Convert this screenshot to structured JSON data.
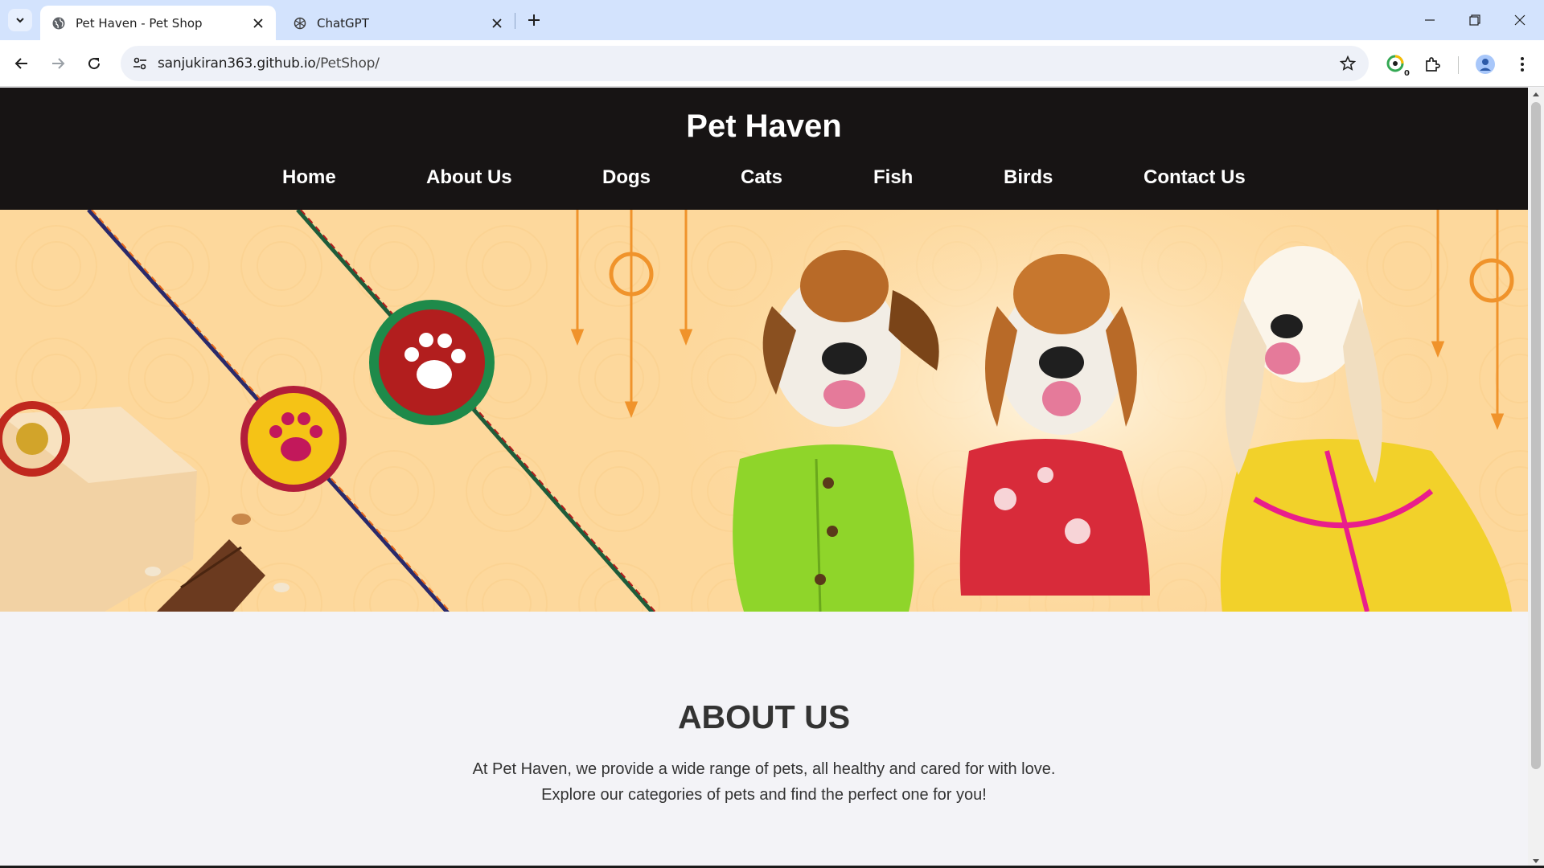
{
  "browser": {
    "tabs": [
      {
        "title": "Pet Haven - Pet Shop",
        "active": true,
        "favicon": "globe-icon"
      },
      {
        "title": "ChatGPT",
        "active": false,
        "favicon": "chatgpt-icon"
      }
    ],
    "url_host": "sanjukiran363.github.io",
    "url_path": "/PetShop/",
    "extension_badge": "0",
    "accent_color": "#d3e3fd"
  },
  "site": {
    "title": "Pet Haven",
    "nav": [
      "Home",
      "About Us",
      "Dogs",
      "Cats",
      "Fish",
      "Birds",
      "Contact Us"
    ],
    "header_color": "#171414"
  },
  "banner": {
    "description_icons": [
      "rakhi-paw-red",
      "rakhi-paw-yellow",
      "dog-green-shirt",
      "dog-red-shirt",
      "dog-yellow-kurta"
    ],
    "background_color": "#fdd89c"
  },
  "about": {
    "title": "ABOUT US",
    "line1": "At Pet Haven, we provide a wide range of pets, all healthy and cared for with love.",
    "line2": "Explore our categories of pets and find the perfect one for you!"
  }
}
